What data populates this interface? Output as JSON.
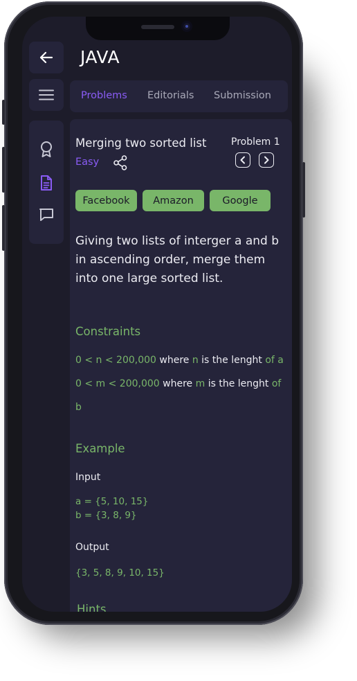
{
  "header": {
    "title": "JAVA"
  },
  "tabs": [
    "Problems",
    "Editorials",
    "Submission"
  ],
  "problem": {
    "title": "Merging two sorted list",
    "difficulty": "Easy",
    "number_label": "Problem 1",
    "tags": [
      "Facebook",
      "Amazon",
      "Google"
    ],
    "description": "Giving two lists of interger a and b in ascending order, merge them into one large sorted list."
  },
  "constraints": {
    "heading": "Constraints",
    "line1": {
      "range": "0 < n < 200,000",
      "where": " where ",
      "var": "n",
      "mid": " is the lenght ",
      "tail": "of a"
    },
    "line2": {
      "range": "0 < m < 200,000",
      "where": " where ",
      "var": "m",
      "mid": " is the lenght ",
      "tail": "of"
    },
    "line3": "b"
  },
  "example": {
    "heading": "Example",
    "input_label": "Input",
    "input_a": "a = {5, 10, 15}",
    "input_b": "b = {3, 8, 9}",
    "output_label": "Output",
    "output_value": "{3, 5, 8, 9, 10, 15}"
  },
  "hints": {
    "heading": "Hints"
  },
  "colors": {
    "accent_purple": "#8a5cf5",
    "accent_green": "#79b669",
    "background": "#1d1c2a",
    "surface": "#25243a"
  },
  "icons": {
    "back": "arrow-left-icon",
    "menu": "menu-icon",
    "sidebar": [
      "award-icon",
      "document-icon",
      "chat-icon"
    ],
    "share": "share-icon",
    "prev": "chevron-left-icon",
    "next": "chevron-right-icon"
  }
}
